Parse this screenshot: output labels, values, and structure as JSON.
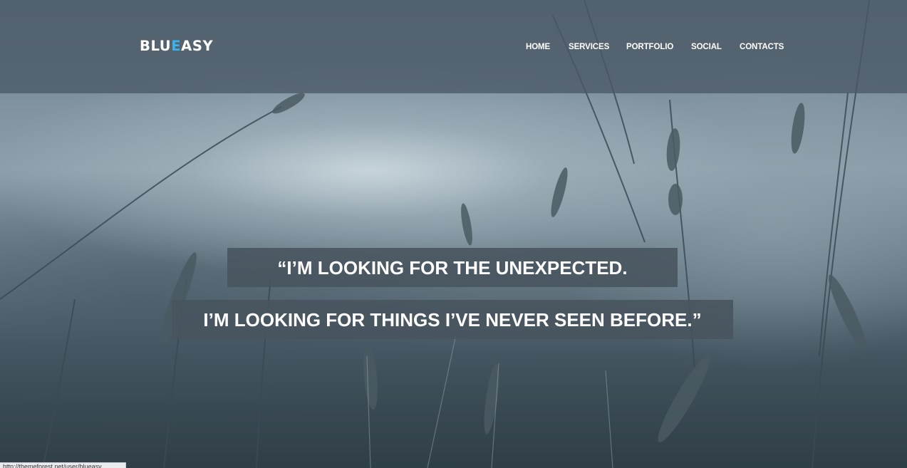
{
  "brand": {
    "prefix": "BLU",
    "accent": "E",
    "suffix": "ASY",
    "accent_color": "#3db2e8"
  },
  "nav": {
    "items": [
      {
        "label": "HOME"
      },
      {
        "label": "SERVICES"
      },
      {
        "label": "PORTFOLIO"
      },
      {
        "label": "SOCIAL"
      },
      {
        "label": "CONTACTS"
      }
    ]
  },
  "quote": {
    "line1": "“I’M LOOKING FOR THE UNEXPECTED.",
    "line2": "I’M LOOKING FOR THINGS I’VE NEVER SEEN BEFORE.”"
  },
  "colors": {
    "header_bg": "#4a5965",
    "quote_bg": "#48545e",
    "text": "#ffffff"
  },
  "status_bar": {
    "url": "http://themeforest.net/user/blueasy"
  }
}
